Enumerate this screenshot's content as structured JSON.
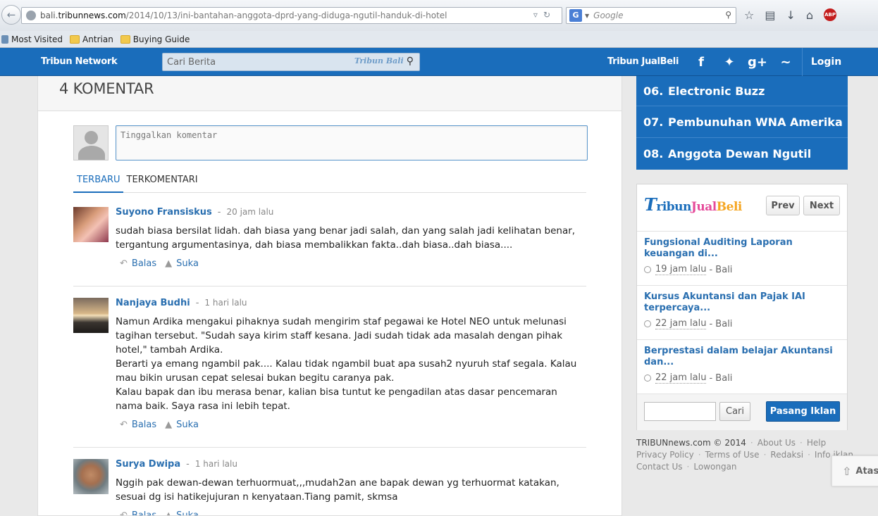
{
  "browser": {
    "url_prefix": "bali.",
    "url_domain": "tribunnews.com",
    "url_path": "/2014/10/13/ini-bantahan-anggota-dprd-yang-diduga-ngutil-handuk-di-hotel",
    "search_engine_label": "G",
    "search_placeholder": "Google",
    "bookmarks": [
      "Most Visited",
      "Antrian",
      "Buying Guide"
    ]
  },
  "nav": {
    "brand": "Tribun Network",
    "search_placeholder": "Cari Berita",
    "search_logo": "Tribun Bali",
    "jualbeli_link": "Tribun JualBeli",
    "social": [
      "f",
      "t",
      "g+",
      "rss"
    ],
    "login": "Login"
  },
  "comments": {
    "header": "4 KOMENTAR",
    "input_placeholder": "Tinggalkan komentar",
    "tabs": [
      "TERBARU",
      "TERKOMENTARI"
    ],
    "items": [
      {
        "author": "Suyono Fransiskus",
        "time": "20 jam lalu",
        "paragraphs": [
          "sudah biasa bersilat lidah. dah biasa yang benar jadi salah, dan yang salah jadi kelihatan benar, tergantung argumentasinya, dah biasa membalikkan fakta..dah biasa..dah biasa...."
        ]
      },
      {
        "author": "Nanjaya Budhi",
        "time": "1 hari lalu",
        "paragraphs": [
          "Namun Ardika mengakui pihaknya sudah mengirim staf pegawai ke Hotel NEO untuk melunasi tagihan tersebut. \"Sudah saya kirim staff kesana. Jadi sudah tidak ada masalah dengan pihak hotel,\" tambah Ardika.",
          "Berarti ya emang ngambil pak.... Kalau tidak ngambil buat apa susah2 nyuruh staf segala. Kalau mau bikin urusan cepat selesai bukan begitu caranya pak.",
          "Kalau bapak dan ibu merasa benar, kalian bisa tuntut ke pengadilan atas dasar pencemaran nama baik. Saya rasa ini lebih tepat."
        ]
      },
      {
        "author": "Surya Dwipa",
        "time": "1 hari lalu",
        "paragraphs": [
          "Nggih pak dewan-dewan terhuormuat,,,mudah2an ane bapak dewan yg terhuormat katakan, sesuai dg isi hatikejujuran n kenyataan.Tiang pamit, skmsa"
        ]
      }
    ],
    "reply_label": "Balas",
    "like_label": "Suka"
  },
  "popular": [
    {
      "num": "06.",
      "title": "Electronic Buzz"
    },
    {
      "num": "07.",
      "title": "Pembunuhan WNA Amerika"
    },
    {
      "num": "08.",
      "title": "Anggota Dewan Ngutil"
    }
  ],
  "jualbeli": {
    "logo_t": "T",
    "logo_ribun": "ribun",
    "logo_jual": "Jual",
    "logo_beli": "Beli",
    "prev": "Prev",
    "next": "Next",
    "ads": [
      {
        "title": "Fungsional Auditing Laporan keuangan di...",
        "time": "19 jam lalu",
        "location": "- Bali"
      },
      {
        "title": "Kursus Akuntansi dan Pajak IAI terpercaya...",
        "time": "22 jam lalu",
        "location": "- Bali"
      },
      {
        "title": "Berprestasi dalam belajar Akuntansi dan...",
        "time": "22 jam lalu",
        "location": "- Bali"
      }
    ],
    "search_button": "Cari",
    "post_button": "Pasang Iklan"
  },
  "footer": {
    "copyright": "TRIBUNnews.com © 2014",
    "links_row1": [
      "About Us",
      "Help"
    ],
    "links_row2": [
      "Privacy Policy",
      "Terms of Use",
      "Redaksi",
      "Info iklan"
    ],
    "links_row3": [
      "Contact Us",
      "Lowongan"
    ]
  },
  "back_to_top": "Atas"
}
